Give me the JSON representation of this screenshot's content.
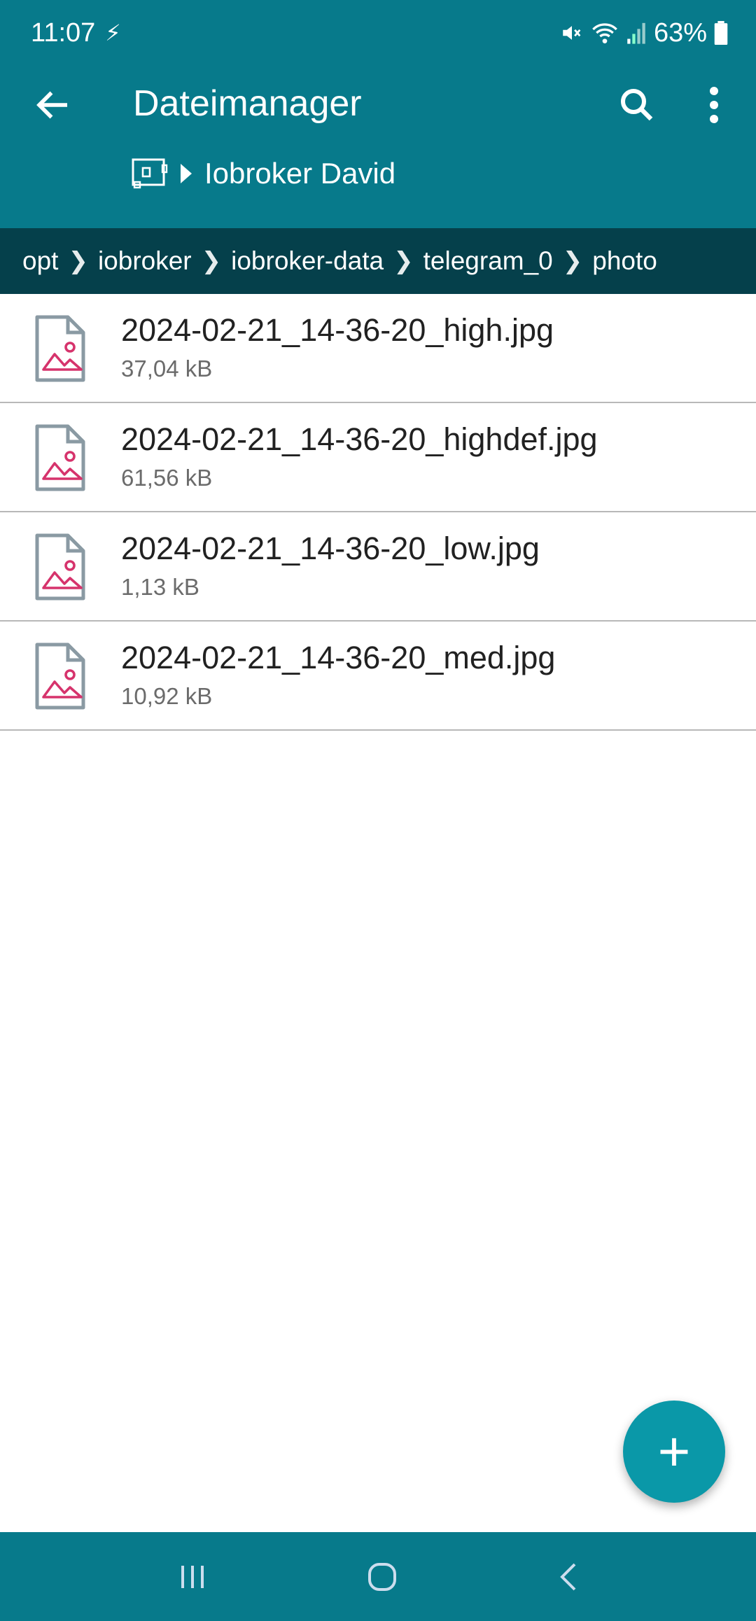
{
  "status": {
    "time": "11:07",
    "battery": "63%"
  },
  "header": {
    "title": "Dateimanager",
    "device": "Iobroker David"
  },
  "breadcrumb": [
    "opt",
    "iobroker",
    "iobroker-data",
    "telegram_0",
    "photo"
  ],
  "files": [
    {
      "name": "2024-02-21_14-36-20_high.jpg",
      "size": "37,04 kB"
    },
    {
      "name": "2024-02-21_14-36-20_highdef.jpg",
      "size": "61,56 kB"
    },
    {
      "name": "2024-02-21_14-36-20_low.jpg",
      "size": "1,13 kB"
    },
    {
      "name": "2024-02-21_14-36-20_med.jpg",
      "size": "10,92 kB"
    }
  ],
  "fab": {
    "label": "+"
  },
  "colors": {
    "header": "#077a8b",
    "breadcrumb": "#05404b",
    "fab": "#0a98a8",
    "image_icon": "#d6336c"
  }
}
